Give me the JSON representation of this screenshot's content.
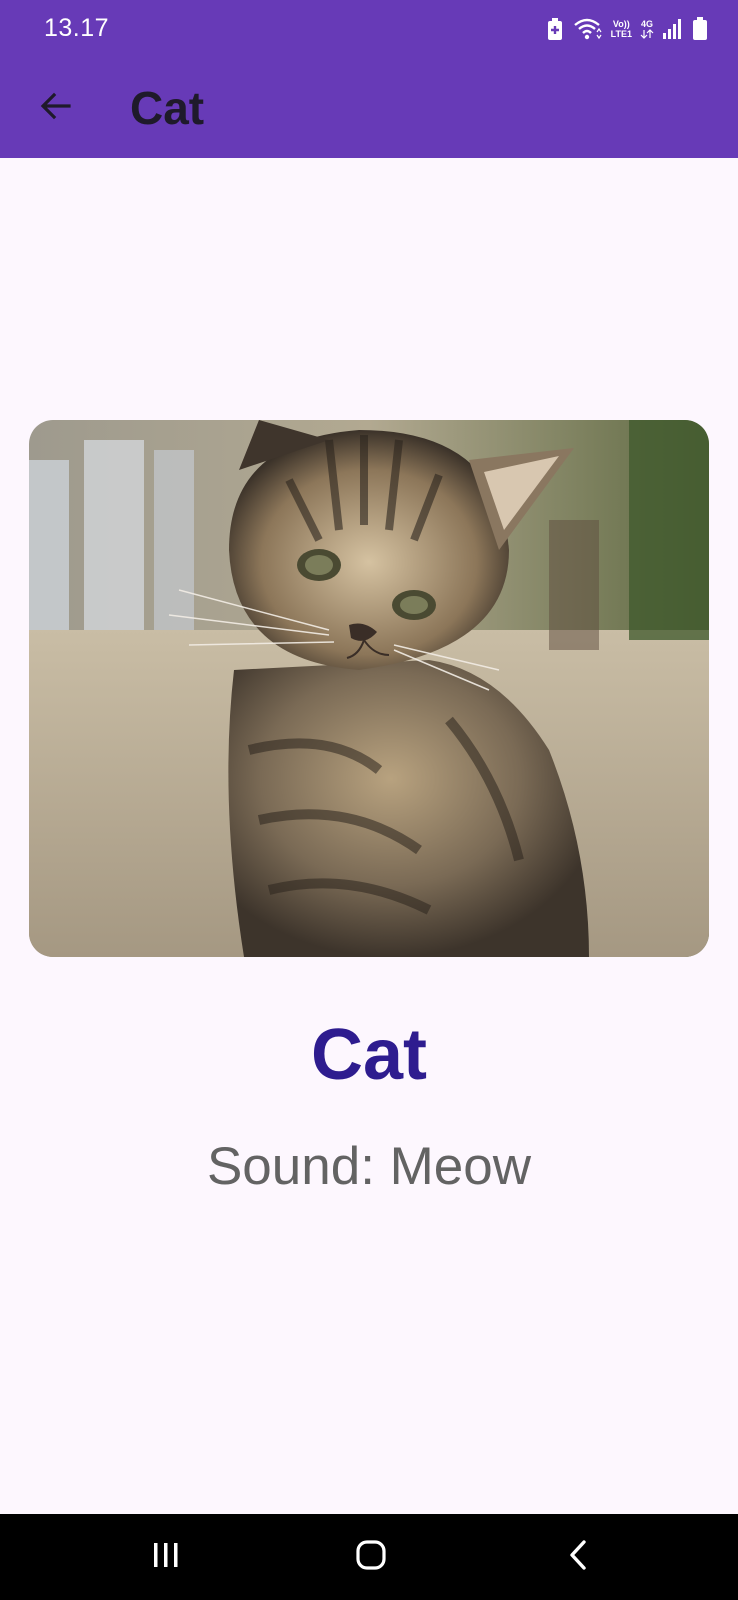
{
  "status_bar": {
    "time": "13.17",
    "icons": [
      "battery-saver-icon",
      "wifi-icon",
      "volte-icon",
      "signal-icon",
      "battery-icon"
    ],
    "volte_top": "Vo))",
    "volte_bottom": "LTE1",
    "network": "4G"
  },
  "app_bar": {
    "title": "Cat",
    "back_icon": "arrow-back-icon"
  },
  "content": {
    "name": "Cat",
    "sound": "Sound: Meow"
  },
  "nav_bar": {
    "icons": [
      "recents-icon",
      "home-icon",
      "back-icon"
    ]
  },
  "colors": {
    "primary": "#673ab7",
    "background": "#fdf7fe",
    "title_text": "#1f1a2b",
    "name_text": "#2e1c8f",
    "sound_text": "#636363"
  }
}
